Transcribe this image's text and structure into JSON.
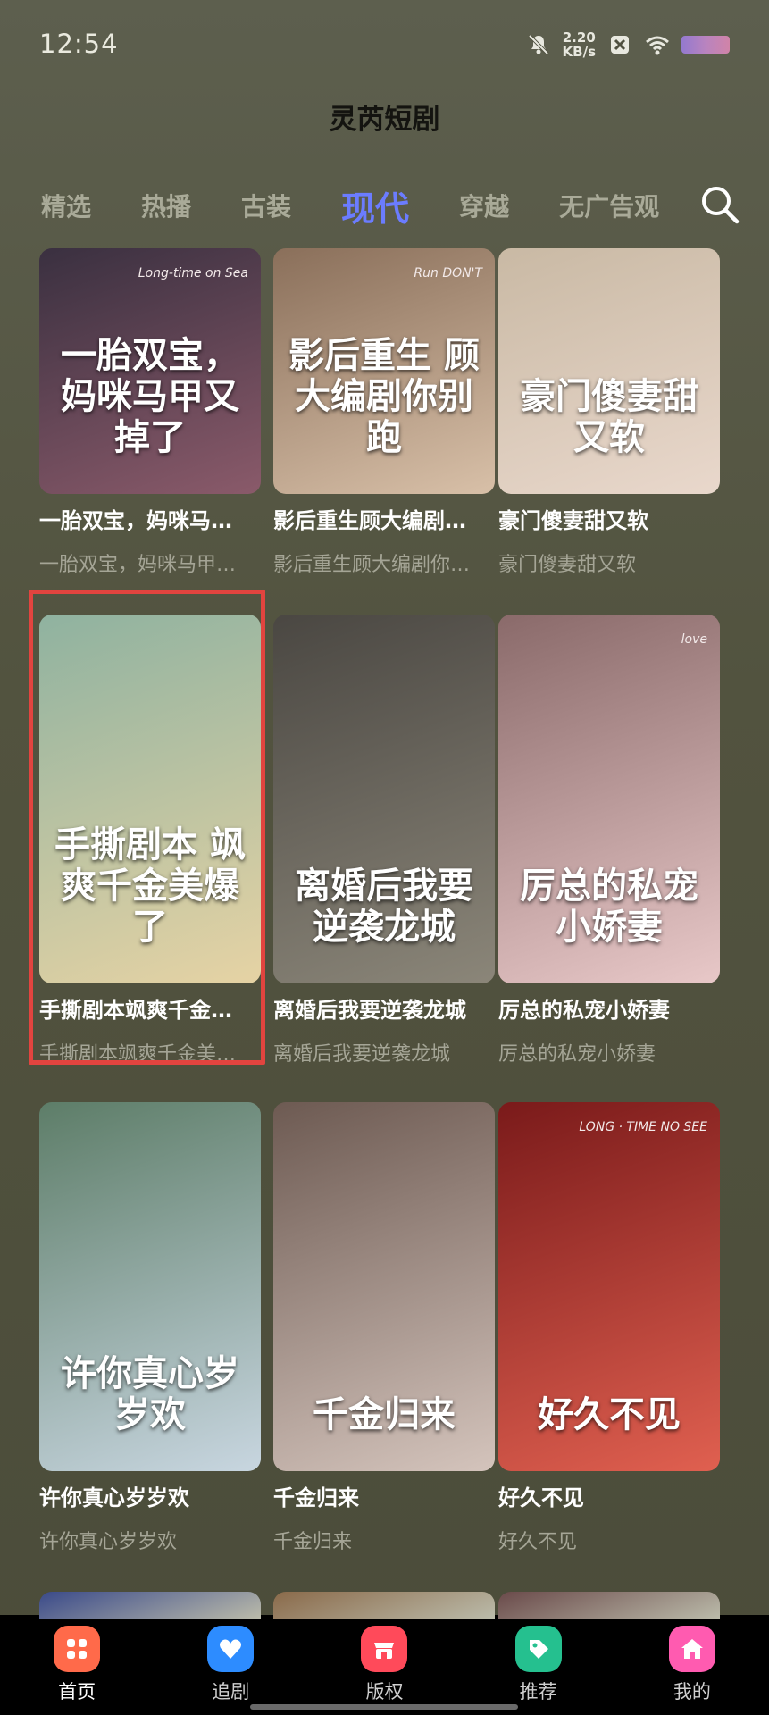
{
  "status": {
    "time": "12:54",
    "speed_value": "2.20",
    "speed_unit": "KB/s"
  },
  "app": {
    "title": "灵芮短剧"
  },
  "tabs": [
    {
      "label": "精选",
      "active": false
    },
    {
      "label": "热播",
      "active": false
    },
    {
      "label": "古装",
      "active": false
    },
    {
      "label": "现代",
      "active": true
    },
    {
      "label": "穿越",
      "active": false
    },
    {
      "label": "无广告观",
      "active": false
    }
  ],
  "cards": [
    {
      "title": "一胎双宝，妈咪马…",
      "subtitle": "一胎双宝，妈咪马甲…",
      "poster_text": "一胎双宝，妈咪马甲又掉了",
      "poster_sub": "Long-time on Sea",
      "colors": [
        "#3a3040",
        "#8a5a6a"
      ]
    },
    {
      "title": "影后重生顾大编剧…",
      "subtitle": "影后重生顾大编剧你…",
      "poster_text": "影后重生 顾大编剧你别跑",
      "poster_sub": "Run DON'T",
      "colors": [
        "#8a6f5a",
        "#d8c0a8"
      ]
    },
    {
      "title": "豪门傻妻甜又软",
      "subtitle": "豪门傻妻甜又软",
      "poster_text": "豪门傻妻甜又软",
      "poster_sub": "",
      "colors": [
        "#c9b9a4",
        "#e9d8cc"
      ]
    },
    {
      "title": "手撕剧本飒爽千金…",
      "subtitle": "手撕剧本飒爽千金美…",
      "poster_text": "手撕剧本 飒爽千金美爆了",
      "poster_sub": "",
      "colors": [
        "#8fb2a0",
        "#e6d3a4"
      ]
    },
    {
      "title": "离婚后我要逆袭龙城",
      "subtitle": "离婚后我要逆袭龙城",
      "poster_text": "离婚后我要逆袭龙城",
      "poster_sub": "",
      "colors": [
        "#4a4742",
        "#8b8679"
      ]
    },
    {
      "title": "厉总的私宠小娇妻",
      "subtitle": "厉总的私宠小娇妻",
      "poster_text": "厉总的私宠小娇妻",
      "poster_sub": "love",
      "colors": [
        "#8a6a6a",
        "#e8c8c8"
      ]
    },
    {
      "title": "许你真心岁岁欢",
      "subtitle": "许你真心岁岁欢",
      "poster_text": "许你真心岁岁欢",
      "poster_sub": "",
      "colors": [
        "#5d7d68",
        "#c8d6e0"
      ]
    },
    {
      "title": "千金归来",
      "subtitle": "千金归来",
      "poster_text": "千金归来",
      "poster_sub": "",
      "colors": [
        "#6d5a52",
        "#d4c4bc"
      ]
    },
    {
      "title": "好久不见",
      "subtitle": "好久不见",
      "poster_text": "好久不见",
      "poster_sub": "LONG · TIME NO SEE",
      "colors": [
        "#7a1a1a",
        "#e06050"
      ]
    }
  ],
  "bottom_nav": [
    {
      "label": "首页",
      "icon": "grid-icon",
      "color": "#ff6a4a",
      "active": true
    },
    {
      "label": "追剧",
      "icon": "heart-icon",
      "color": "#2d8cff",
      "active": false
    },
    {
      "label": "版权",
      "icon": "store-icon",
      "color": "#ff4a5a",
      "active": false
    },
    {
      "label": "推荐",
      "icon": "tag-icon",
      "color": "#25c08f",
      "active": false
    },
    {
      "label": "我的",
      "icon": "home-icon",
      "color": "#ff5bb0",
      "active": false
    }
  ]
}
